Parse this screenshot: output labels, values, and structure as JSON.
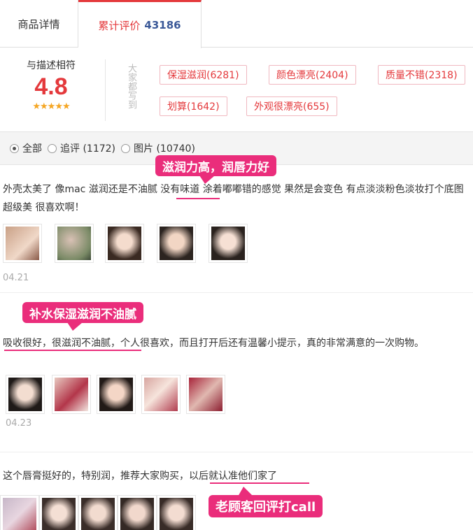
{
  "tabs": {
    "details": "商品详情",
    "reviews": "累计评价",
    "review_count": "43186"
  },
  "summary": {
    "score_label": "与描述相符",
    "score": "4.8",
    "stars": "★★★★★",
    "vertical_note": "大家都写到",
    "tags": [
      "保湿滋润(6281)",
      "颜色漂亮(2404)",
      "质量不错(2318)",
      "划算(1642)",
      "外观很漂亮(655)"
    ]
  },
  "filter": {
    "all": "全部",
    "followup": "追评 (1172)",
    "images": "图片 (10740)"
  },
  "reviews": [
    {
      "text": "外壳太美了 像mac 滋润还是不油腻 没有味道 涂着嘟嘟错的感觉 果然是会变色 有点淡淡粉色淡妆打个底图超级美 很喜欢啊！",
      "date": "04.21",
      "callout": "滋润力高，润唇力好"
    },
    {
      "text": "吸收很好，很滋润不油腻，个人很喜欢，而且打开后还有温馨小提示，真的非常满意的一次购物。",
      "date": "04.23",
      "callout": "补水保湿滋润不油腻"
    },
    {
      "text": "这个唇膏挺好的，特别润，推荐大家购买，以后就认准他们家了",
      "date": "",
      "callout": "老顾客回评打call"
    }
  ],
  "colors": {
    "accent": "#e4393c",
    "callout": "#ea2d7b"
  }
}
